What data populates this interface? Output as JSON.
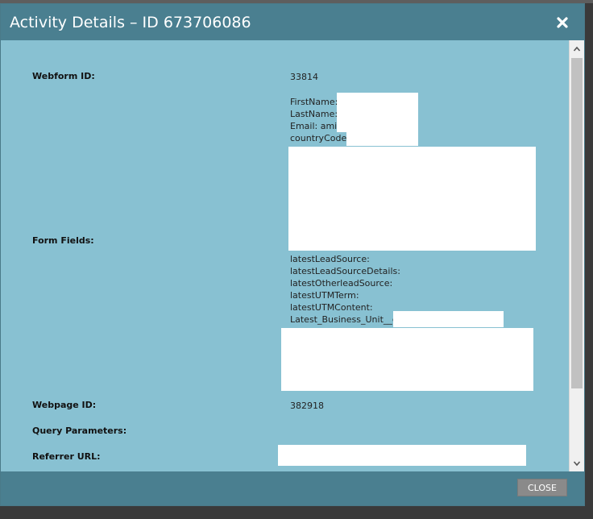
{
  "dialog": {
    "title": "Activity Details – ID 673706086",
    "close_icon": "close-icon",
    "close_button_label": "CLOSE"
  },
  "details": {
    "webform_id": {
      "label": "Webform ID:",
      "value": "33814"
    },
    "form_fields": {
      "label": "Form Fields:",
      "lines": [
        "FirstName:",
        "LastName:",
        "Email: amit",
        "countryCode:",
        "latestLeadSource:",
        "latestLeadSourceDetails:",
        "latestOtherleadSource:",
        "latestUTMTerm:",
        "latestUTMContent:",
        "Latest_Business_Unit__c:"
      ]
    },
    "webpage_id": {
      "label": "Webpage ID:",
      "value": "382918"
    },
    "query_parameters": {
      "label": "Query Parameters:",
      "value": ""
    },
    "referrer_url": {
      "label": "Referrer URL:",
      "value": ""
    }
  },
  "scrollbar": {
    "up_icon": "chevron-up-icon",
    "down_icon": "chevron-down-icon"
  },
  "colors": {
    "titlebar": "#4a7f90",
    "body": "#88c1d2",
    "redaction": "#ffffff",
    "close_button": "#8a8a8a"
  }
}
